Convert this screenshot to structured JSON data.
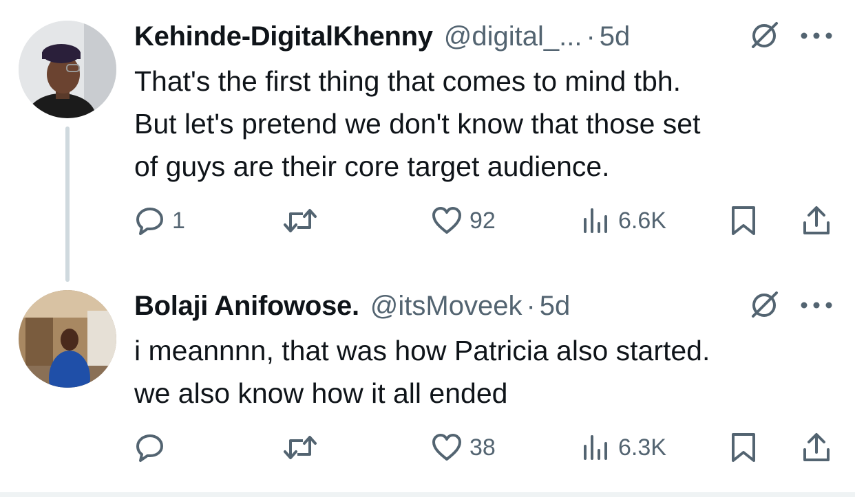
{
  "colors": {
    "text": "#0f1419",
    "secondary": "#536471",
    "thread_line": "#cfd9de"
  },
  "tweets": [
    {
      "avatar_icon": "user-avatar-photo",
      "name": "Kehinde-DigitalKhenny",
      "handle": "@digital_...",
      "separator": "·",
      "time": "5d",
      "lines": [
        "That's the first thing that comes to mind tbh.",
        "But let's pretend we don't know that those set",
        "of guys are their core target audience."
      ],
      "reply_count": "1",
      "retweet_count": "",
      "like_count": "92",
      "view_count": "6.6K"
    },
    {
      "avatar_icon": "user-avatar-photo",
      "name": "Bolaji Anifowose.",
      "handle": "@itsMoveek",
      "separator": "·",
      "time": "5d",
      "lines": [
        "i meannnn, that was how Patricia also started.",
        "we also know how it all ended"
      ],
      "reply_count": "",
      "retweet_count": "",
      "like_count": "38",
      "view_count": "6.3K"
    }
  ]
}
